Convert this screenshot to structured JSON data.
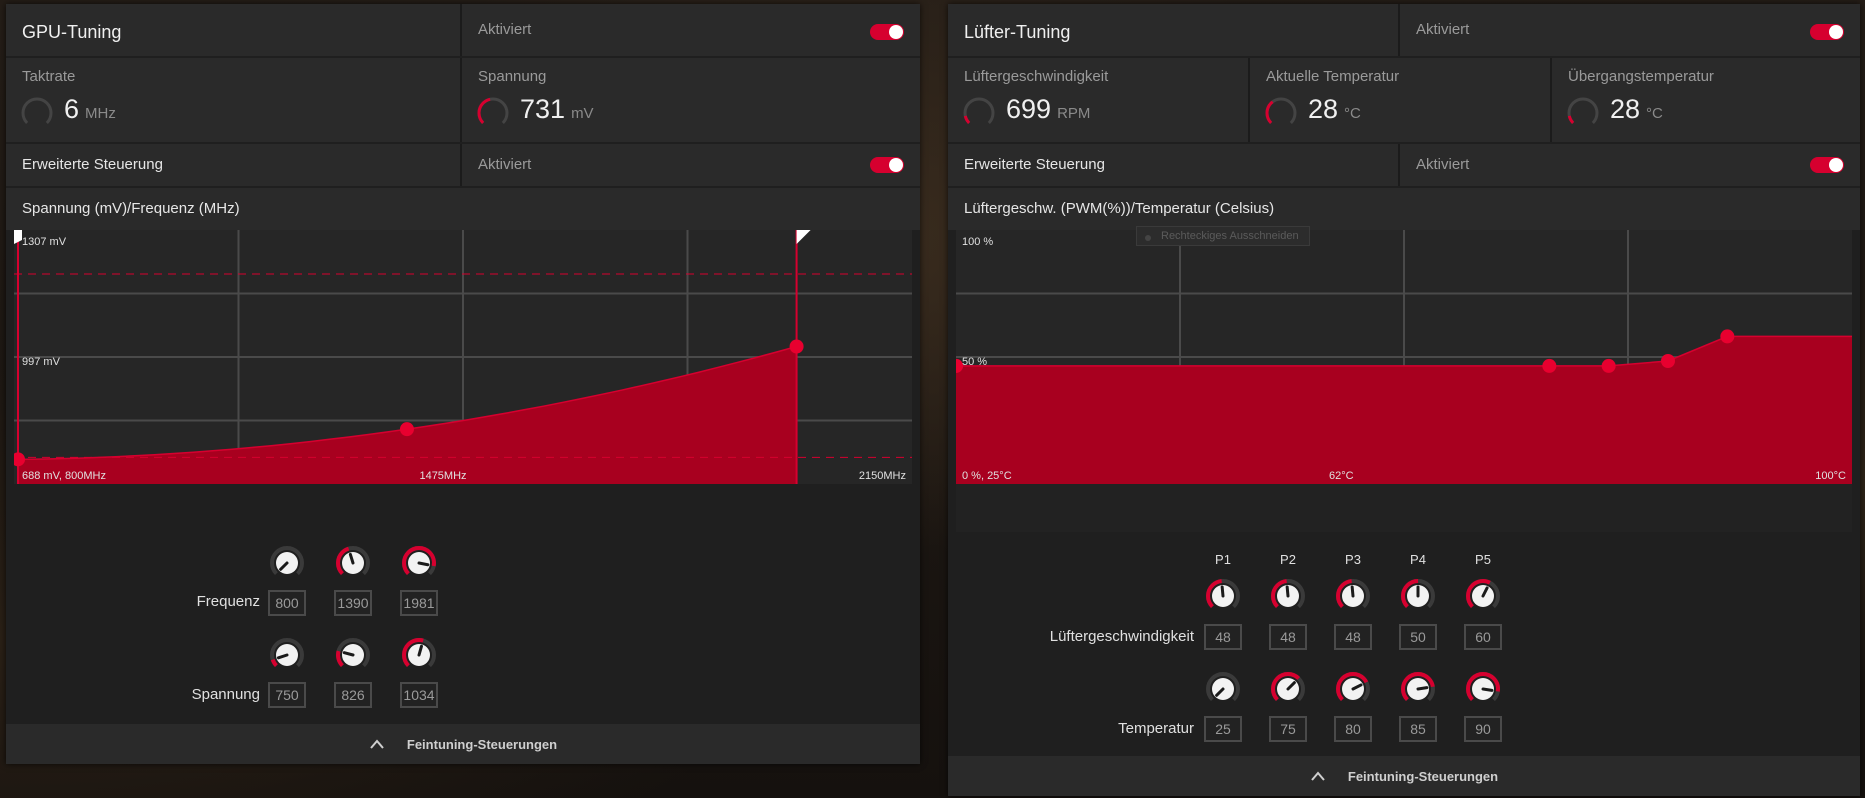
{
  "gpu": {
    "title": "GPU-Tuning",
    "status": "Aktiviert",
    "clock_label": "Taktrate",
    "clock_value": "6",
    "clock_unit": "MHz",
    "voltage_label": "Spannung",
    "voltage_value": "731",
    "voltage_unit": "mV",
    "advanced_label": "Erweiterte Steuerung",
    "advanced_status": "Aktiviert",
    "chart_title": "Spannung (mV)/Frequenz (MHz)",
    "freq_label": "Frequenz",
    "volt_label": "Spannung",
    "freq_values": [
      "800",
      "1390",
      "1981"
    ],
    "volt_values": [
      "750",
      "826",
      "1034"
    ],
    "footer": "Feintuning-Steuerungen"
  },
  "fan": {
    "title": "Lüfter-Tuning",
    "status": "Aktiviert",
    "speed_label": "Lüftergeschwindigkeit",
    "speed_value": "699",
    "speed_unit": "RPM",
    "temp_label": "Aktuelle Temperatur",
    "temp_value": "28",
    "temp_unit": "°C",
    "junction_label": "Übergangstemperatur",
    "junction_value": "28",
    "junction_unit": "°C",
    "advanced_label": "Erweiterte Steuerung",
    "advanced_status": "Aktiviert",
    "chart_title": "Lüftergeschw. (PWM(%))/Temperatur (Celsius)",
    "tooltip": "Rechteckiges Ausschneiden",
    "p_labels": [
      "P1",
      "P2",
      "P3",
      "P4",
      "P5"
    ],
    "speed_row_label": "Lüftergeschwindigkeit",
    "temp_row_label": "Temperatur",
    "speed_values": [
      "48",
      "48",
      "48",
      "50",
      "60"
    ],
    "temp_values": [
      "25",
      "75",
      "80",
      "85",
      "90"
    ],
    "footer": "Feintuning-Steuerungen"
  },
  "chart_data": [
    {
      "type": "area",
      "title": "Spannung (mV)/Frequenz (MHz)",
      "y_tick_labels": [
        "1307 mV",
        "997 mV"
      ],
      "x_tick_labels": [
        "688 mV, 800MHz",
        "1475MHz",
        "2150MHz"
      ],
      "xlim": [
        800,
        2150
      ],
      "ylim": [
        688,
        1307
      ],
      "series": [
        {
          "x": [
            800,
            1390,
            1981
          ],
          "y": [
            750,
            826,
            1034
          ]
        }
      ],
      "limits": {
        "x_max": 1981
      },
      "grid": true,
      "color": "#c8002b"
    },
    {
      "type": "area",
      "title": "Lüftergeschw. (PWM(%))/Temperatur (Celsius)",
      "y_tick_labels": [
        "100 %",
        "50 %"
      ],
      "x_tick_labels": [
        "0 %, 25°C",
        "62°C",
        "100°C"
      ],
      "xlim": [
        25,
        100
      ],
      "ylim": [
        0,
        100
      ],
      "series": [
        {
          "x": [
            25,
            75,
            80,
            85,
            90
          ],
          "y": [
            48,
            48,
            48,
            50,
            60
          ]
        }
      ],
      "grid": true,
      "color": "#c8002b"
    }
  ],
  "colors": {
    "accent": "#d6002f",
    "fill": "#a8001f",
    "panel": "#2a2a2a"
  }
}
